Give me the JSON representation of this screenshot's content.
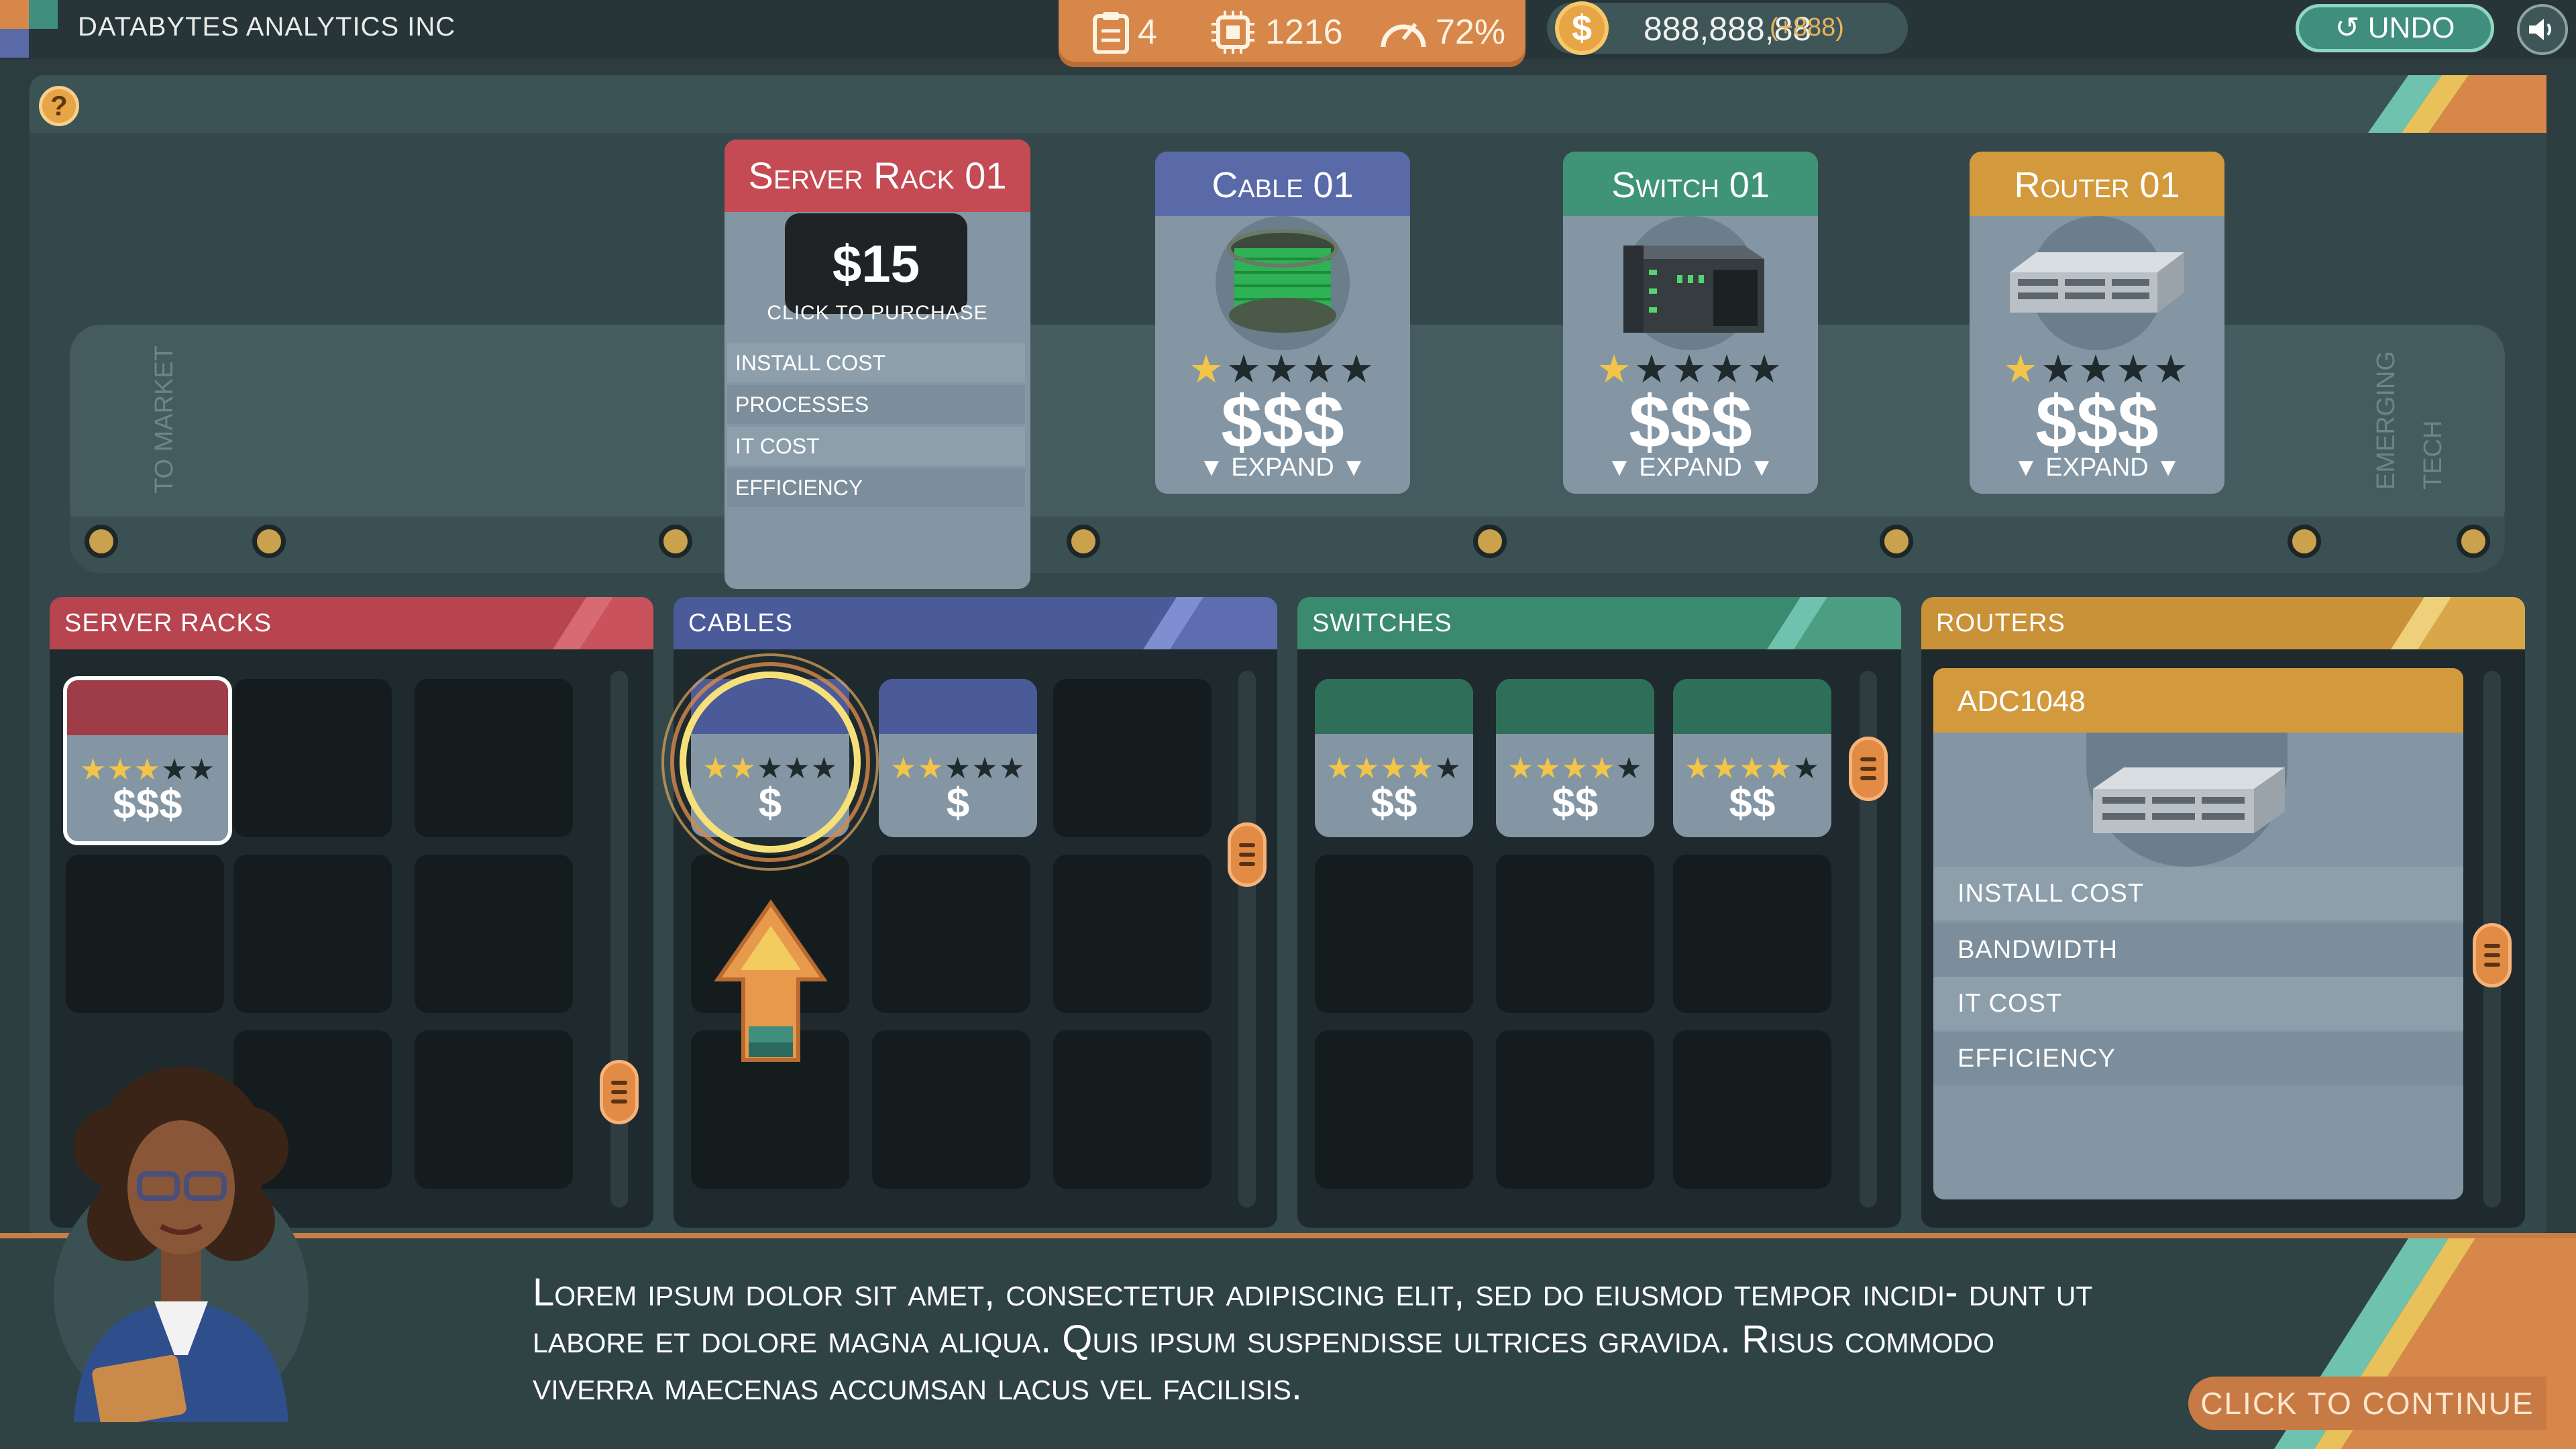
{
  "company": {
    "name": "DATABYTES ANALYTICS INC"
  },
  "stats": {
    "documents": "4",
    "cpu": "1216",
    "efficiency": "72%"
  },
  "money": {
    "amount": "888,888,88",
    "delta": "(+888)",
    "symbol": "$"
  },
  "controls": {
    "undo": "UNDO",
    "help": "?"
  },
  "market": {
    "left_label": "TO MARKET",
    "right_label": "EMERGING TECH",
    "selected_card": {
      "title": "Server Rack 01",
      "price": "$15",
      "purchase_hint": "CLICK TO PURCHASE",
      "rows": [
        "INSTALL COST",
        "PROCESSES",
        "IT COST",
        "EFFICIENCY"
      ]
    },
    "cards": [
      {
        "title": "Cable 01",
        "price": "$$$",
        "expand": "▼ EXPAND ▼",
        "rating": 1,
        "color": "#5a6aa8"
      },
      {
        "title": "Switch 01",
        "price": "$$$",
        "expand": "▼ EXPAND ▼",
        "rating": 1,
        "color": "#3f9478"
      },
      {
        "title": "Router 01",
        "price": "$$$",
        "expand": "▼ EXPAND ▼",
        "rating": 1,
        "color": "#d39a3d"
      }
    ]
  },
  "panels": {
    "server_racks": {
      "label": "SERVER RACKS",
      "color": "#b8444f",
      "items": [
        {
          "price": "$$$",
          "rating": 3
        }
      ]
    },
    "cables": {
      "label": "CABLES",
      "color": "#4b5a99",
      "items": [
        {
          "price": "$",
          "rating": 2
        },
        {
          "price": "$",
          "rating": 2
        }
      ]
    },
    "switches": {
      "label": "SWITCHES",
      "color": "#3a8a6f",
      "items": [
        {
          "price": "$$",
          "rating": 4
        },
        {
          "price": "$$",
          "rating": 4
        },
        {
          "price": "$$",
          "rating": 4
        }
      ]
    },
    "routers": {
      "label": "ROUTERS",
      "color": "#c99238",
      "detail": {
        "name": "ADC1048",
        "rows": [
          "INSTALL COST",
          "BANDWIDTH",
          "IT COST",
          "EFFICIENCY"
        ]
      }
    }
  },
  "dialog": {
    "text": "Lorem ipsum dolor sit amet, consectetur adipiscing elit, sed do eiusmod tempor incidi- dunt ut labore et dolore magna aliqua. Quis ipsum suspendisse ultrices gravida. Risus commodo viverra maecenas accumsan lacus vel facilisis.",
    "continue": "CLICK TO CONTINUE"
  },
  "icons": {
    "stats": [
      "clipboard-icon",
      "cpu-chip-icon",
      "speedometer-icon"
    ],
    "undo": "undo-arrow-icon",
    "sound": "speaker-icon"
  }
}
